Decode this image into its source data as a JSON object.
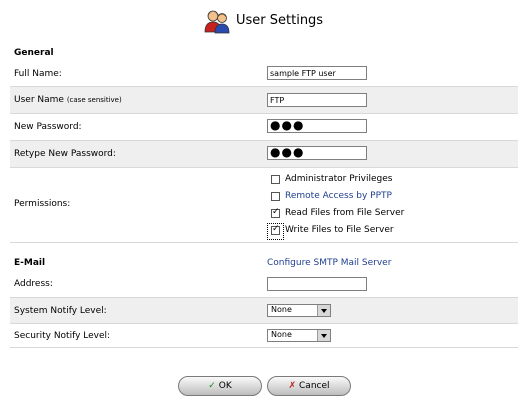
{
  "header": {
    "title": "User Settings",
    "icon": "users-icon"
  },
  "general": {
    "section_label": "General",
    "full_name_label": "Full Name:",
    "full_name_value": "sample FTP user",
    "username_label": "User Name",
    "username_note": "(case sensitive)",
    "username_value": "FTP",
    "new_password_label": "New Password:",
    "new_password_value": "●●●",
    "retype_password_label": "Retype New Password:",
    "retype_password_value": "●●●",
    "permissions_label": "Permissions:",
    "permissions": [
      {
        "label": "Administrator Privileges",
        "checked": false,
        "link": false
      },
      {
        "label": "Remote Access by PPTP",
        "checked": false,
        "link": true
      },
      {
        "label": "Read Files from File Server",
        "checked": true,
        "link": false
      },
      {
        "label": "Write Files to File Server",
        "checked": true,
        "link": false
      }
    ]
  },
  "email": {
    "section_label": "E-Mail",
    "configure_link": "Configure SMTP Mail Server",
    "address_label": "Address:",
    "address_value": "",
    "system_notify_label": "System Notify Level:",
    "system_notify_value": "None",
    "security_notify_label": "Security Notify Level:",
    "security_notify_value": "None"
  },
  "buttons": {
    "ok_label": "OK",
    "cancel_label": "Cancel",
    "ok_color": "#1a8a1a",
    "cancel_color": "#c0201a"
  }
}
